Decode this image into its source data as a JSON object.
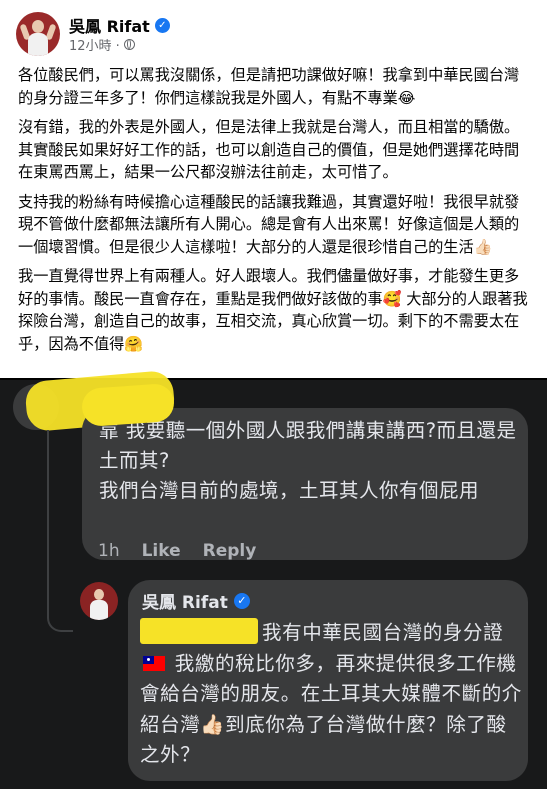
{
  "post": {
    "author": "吳鳳 Rifat",
    "time": "12小時 · ",
    "paragraphs": [
      "各位酸民們，可以罵我沒關係，但是請把功課做好嘛！我拿到中華民國台灣的身分證三年多了！你們這樣說我是外國人，有點不專業😂",
      "沒有錯，我的外表是外國人，但是法律上我就是台灣人，而且相當的驕傲。其實酸民如果好好工作的話，也可以創造自己的價值，但是她們選擇花時間在東罵西罵上，結果一公尺都沒辦法往前走，太可惜了。",
      "支持我的粉絲有時候擔心這種酸民的話讓我難過，其實還好啦！我很早就發現不管做什麼都無法讓所有人開心。總是會有人出來罵！好像這個是人類的一個壞習慣。但是很少人這樣啦！大部分的人還是很珍惜自己的生活👍🏻",
      "我一直覺得世界上有兩種人。好人跟壞人。我們儘量做好事，才能發生更多好的事情。酸民一直會存在，重點是我們做好該做的事🥰 大部分的人跟著我探險台灣，創造自己的故事，互相交流，真心欣賞一切。剩下的不需要太在乎，因為不值得🤗"
    ]
  },
  "comment": {
    "text": "靠 我要聽一個外國人跟我們講東講西?而且還是土而其?\n我們台灣目前的處境，土耳其人你有個屁用",
    "time": "1h",
    "like_label": "Like",
    "reply_label": "Reply"
  },
  "reply": {
    "author": "吳鳳 Rifat",
    "text_a": "我有中華民國台灣的身分證",
    "text_b": " 我繳的稅比你多，再來提供很多工作機會給台灣的朋友。在土耳其大媒體不斷的介紹台灣👍🏻到底你為了台灣做什麼？除了酸之外？"
  },
  "colors": {
    "brand_blue": "#1877f2",
    "dark_bg": "#18191a",
    "bubble_bg": "#3a3b3c",
    "highlight": "#f6e227"
  }
}
